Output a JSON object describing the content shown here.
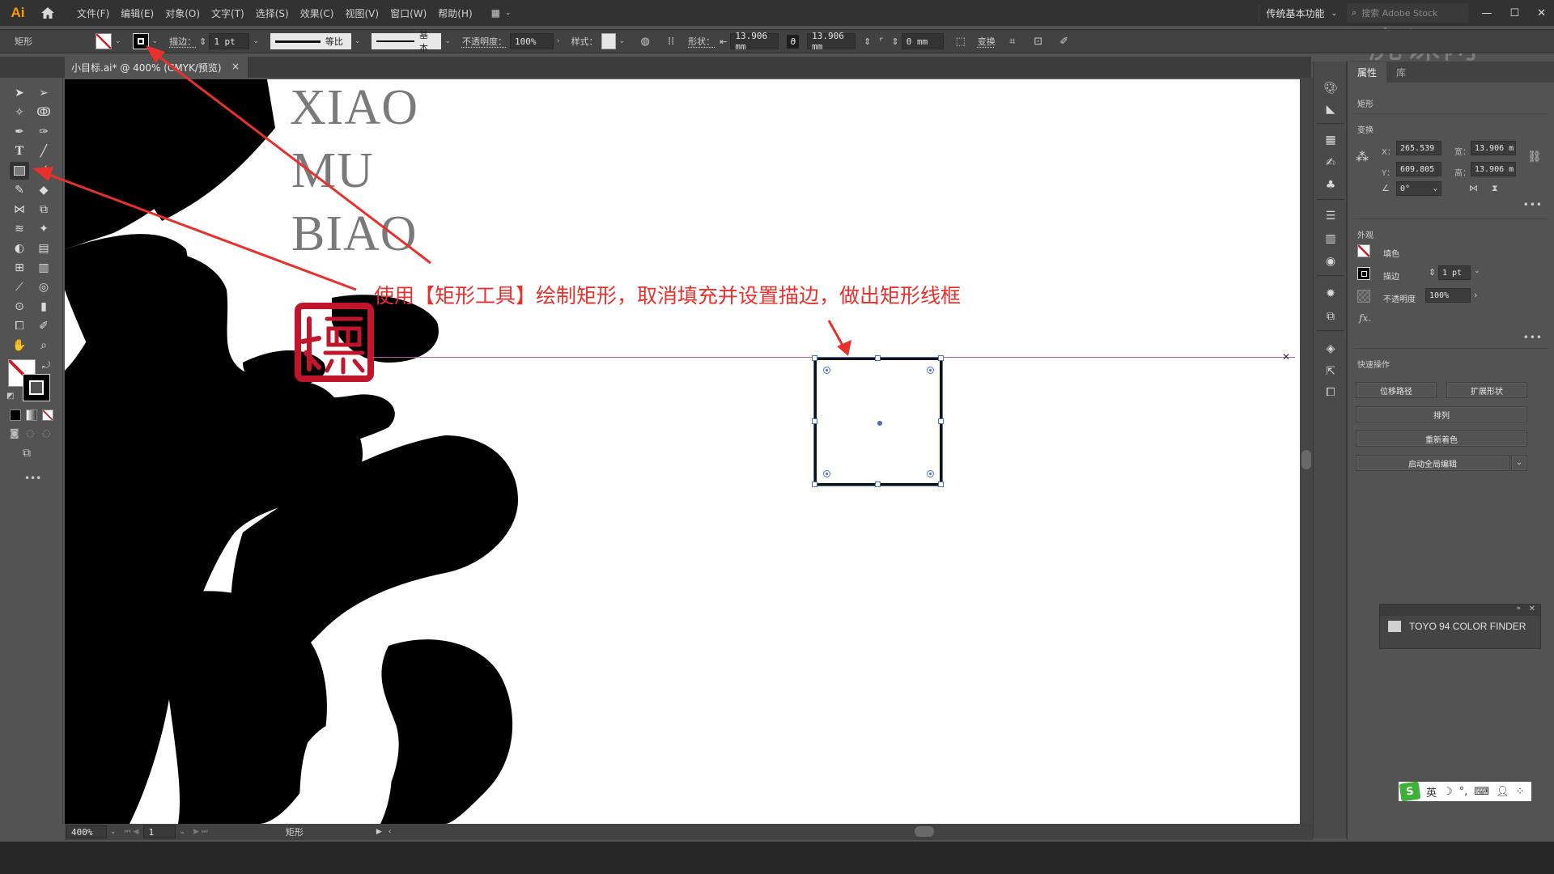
{
  "app": {
    "logo": "Ai",
    "menus": [
      "文件(F)",
      "编辑(E)",
      "对象(O)",
      "文字(T)",
      "选择(S)",
      "效果(C)",
      "视图(V)",
      "窗口(W)",
      "帮助(H)"
    ],
    "workspace": "传统基本功能",
    "stock_search_placeholder": "搜索 Adobe Stock",
    "window_controls": {
      "minimize": "—",
      "maximize": "☐",
      "close": "✕"
    },
    "watermark": "虎课网"
  },
  "control_bar": {
    "object_type": "矩形",
    "stroke_label": "描边：",
    "stroke_weight": "1 pt",
    "profile_label": "等比",
    "brush_label": "基本",
    "opacity_label": "不透明度：",
    "opacity_value": "100%",
    "style_label": "样式：",
    "shape_label": "形状：",
    "width_value": "13.906 mm",
    "height_value": "13.906 mm",
    "corner_value": "0 mm",
    "transform_label": "变换"
  },
  "document_tab": {
    "title": "小目标.ai* @ 400% (CMYK/预览)",
    "close": "×"
  },
  "canvas": {
    "latin_lines": [
      "XIAO",
      "MU",
      "BIAO"
    ],
    "annotation": "使用【矩形工具】绘制矩形，取消填充并设置描边，做出矩形线框",
    "accent_color": "#e8302c",
    "seal_color": "#c0152a"
  },
  "status_bar": {
    "zoom": "400%",
    "artboard": "1",
    "current_tool": "矩形"
  },
  "properties_panel": {
    "tabs": [
      "属性",
      "库"
    ],
    "object_type": "矩形",
    "transform_title": "变换",
    "x_label": "X：",
    "x_value": "265.539",
    "y_label": "Y：",
    "y_value": "609.805",
    "w_label": "宽：",
    "w_value": "13.906 m",
    "h_label": "高：",
    "h_value": "13.906 m",
    "angle_value": "0°",
    "appearance_title": "外观",
    "fill_label": "填色",
    "stroke_label": "描边",
    "stroke_value": "1 pt",
    "opacity_label": "不透明度",
    "opacity_value": "100%",
    "fx_label": "fx.",
    "quick_actions_title": "快速操作",
    "buttons": {
      "offset_path": "位移路径",
      "expand_shape": "扩展形状",
      "arrange": "排列",
      "recolor": "重新着色",
      "global_edit": "启动全局编辑"
    },
    "more": "•••"
  },
  "color_finder": {
    "label": "TOYO 94 COLOR FINDER"
  },
  "ime": {
    "logo": "S",
    "mode": "英",
    "icons": [
      "moon-icon",
      "punctuation-icon",
      "keyboard-icon",
      "user-icon",
      "grid-icon"
    ]
  }
}
